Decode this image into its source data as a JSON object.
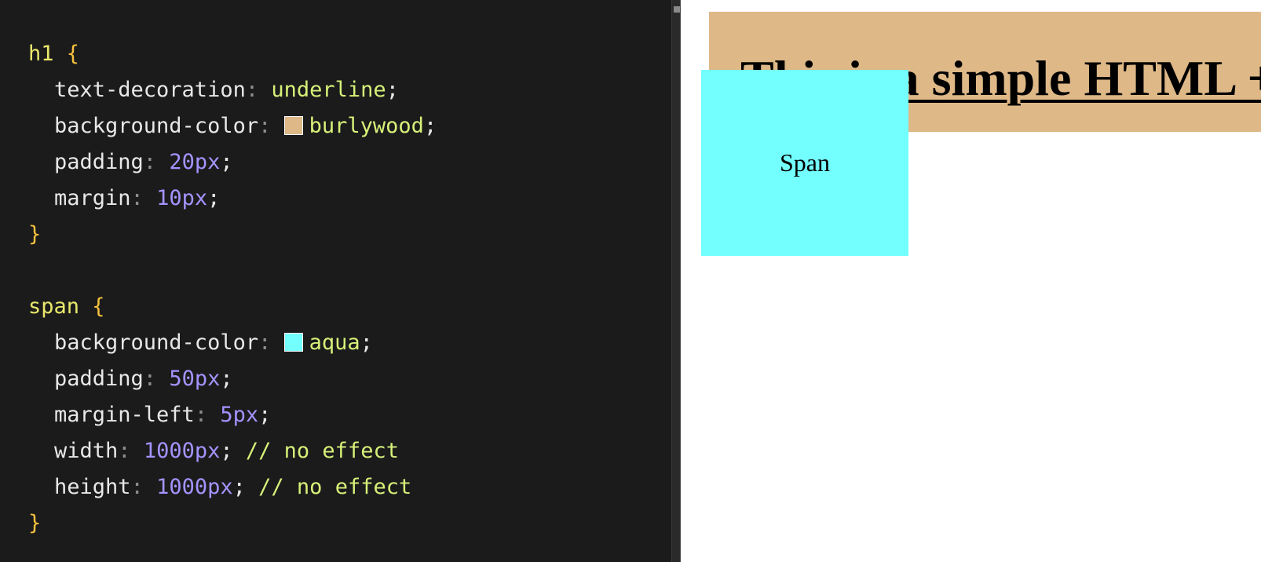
{
  "editor": {
    "lines": [
      {
        "sel": "h1",
        "brace": "{"
      },
      {
        "prop": "text-decoration",
        "colon": ":",
        "kw": "underline",
        "semi": ";"
      },
      {
        "prop": "background-color",
        "colon": ":",
        "kw": "burlywood",
        "semi": ";",
        "swatch": "#deb887"
      },
      {
        "prop": "padding",
        "colon": ":",
        "num": "20px",
        "semi": ";"
      },
      {
        "prop": "margin",
        "colon": ":",
        "num": "10px",
        "semi": ";"
      },
      {
        "brace": "}"
      },
      {
        "blank": ""
      },
      {
        "sel": "span",
        "brace": "{"
      },
      {
        "prop": "background-color",
        "colon": ":",
        "kw": "aqua",
        "semi": ";",
        "swatch": "#73fffe"
      },
      {
        "prop": "padding",
        "colon": ":",
        "num": "50px",
        "semi": ";"
      },
      {
        "prop": "margin-left",
        "colon": ":",
        "num": "5px",
        "semi": ";"
      },
      {
        "prop": "width",
        "colon": ":",
        "num": "1000px",
        "semi": ";",
        "cmt": "// no effect"
      },
      {
        "prop": "height",
        "colon": ":",
        "num": "1000px",
        "semi": ";",
        "cmt": "// no effect"
      },
      {
        "brace": "}"
      }
    ]
  },
  "preview": {
    "h1_text": "This is a simple HTML + CSS example",
    "span_text": "Span"
  },
  "colors": {
    "editor_bg": "#1b1b1b",
    "burlywood": "#deb887",
    "aqua": "#73fffe"
  }
}
